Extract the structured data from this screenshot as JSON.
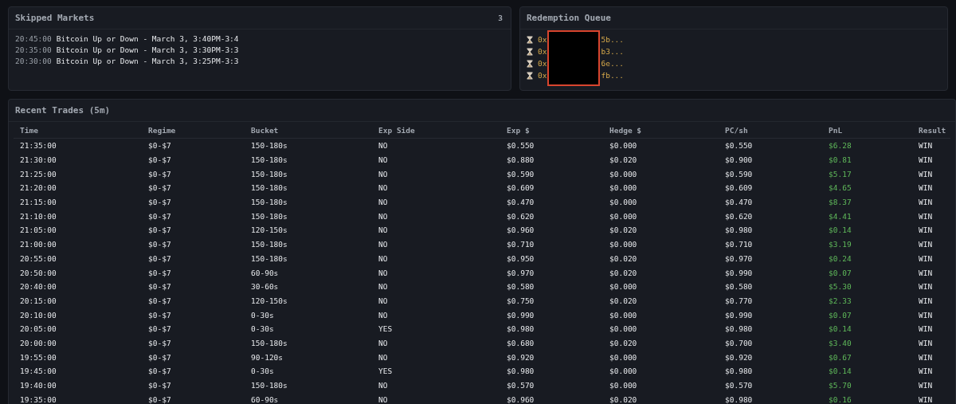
{
  "skipped_markets": {
    "title": "Skipped Markets",
    "count": "3",
    "items": [
      {
        "time": "20:45:00",
        "market": "Bitcoin Up or Down - March 3, 3:40PM-3:4"
      },
      {
        "time": "20:35:00",
        "market": "Bitcoin Up or Down - March 3, 3:30PM-3:3"
      },
      {
        "time": "20:30:00",
        "market": "Bitcoin Up or Down - March 3, 3:25PM-3:3"
      }
    ]
  },
  "redemption_queue": {
    "title": "Redemption Queue",
    "redacted": true,
    "items": [
      {
        "prefix": "0x",
        "suffix": "5b..."
      },
      {
        "prefix": "0x",
        "suffix": "b3..."
      },
      {
        "prefix": "0x",
        "suffix": "6e..."
      },
      {
        "prefix": "0x",
        "suffix": "fb..."
      }
    ]
  },
  "recent_trades": {
    "title": "Recent Trades (5m)",
    "columns": [
      "Time",
      "Regime",
      "Bucket",
      "Exp Side",
      "Exp $",
      "Hedge $",
      "PC/sh",
      "PnL",
      "Result"
    ],
    "rows": [
      [
        "21:35:00",
        "$0-$7",
        "150-180s",
        "NO",
        "$0.550",
        "$0.000",
        "$0.550",
        "$6.28",
        "WIN"
      ],
      [
        "21:30:00",
        "$0-$7",
        "150-180s",
        "NO",
        "$0.880",
        "$0.020",
        "$0.900",
        "$0.81",
        "WIN"
      ],
      [
        "21:25:00",
        "$0-$7",
        "150-180s",
        "NO",
        "$0.590",
        "$0.000",
        "$0.590",
        "$5.17",
        "WIN"
      ],
      [
        "21:20:00",
        "$0-$7",
        "150-180s",
        "NO",
        "$0.609",
        "$0.000",
        "$0.609",
        "$4.65",
        "WIN"
      ],
      [
        "21:15:00",
        "$0-$7",
        "150-180s",
        "NO",
        "$0.470",
        "$0.000",
        "$0.470",
        "$8.37",
        "WIN"
      ],
      [
        "21:10:00",
        "$0-$7",
        "150-180s",
        "NO",
        "$0.620",
        "$0.000",
        "$0.620",
        "$4.41",
        "WIN"
      ],
      [
        "21:05:00",
        "$0-$7",
        "120-150s",
        "NO",
        "$0.960",
        "$0.020",
        "$0.980",
        "$0.14",
        "WIN"
      ],
      [
        "21:00:00",
        "$0-$7",
        "150-180s",
        "NO",
        "$0.710",
        "$0.000",
        "$0.710",
        "$3.19",
        "WIN"
      ],
      [
        "20:55:00",
        "$0-$7",
        "150-180s",
        "NO",
        "$0.950",
        "$0.020",
        "$0.970",
        "$0.24",
        "WIN"
      ],
      [
        "20:50:00",
        "$0-$7",
        "60-90s",
        "NO",
        "$0.970",
        "$0.020",
        "$0.990",
        "$0.07",
        "WIN"
      ],
      [
        "20:40:00",
        "$0-$7",
        "30-60s",
        "NO",
        "$0.580",
        "$0.000",
        "$0.580",
        "$5.30",
        "WIN"
      ],
      [
        "20:15:00",
        "$0-$7",
        "120-150s",
        "NO",
        "$0.750",
        "$0.020",
        "$0.770",
        "$2.33",
        "WIN"
      ],
      [
        "20:10:00",
        "$0-$7",
        "0-30s",
        "NO",
        "$0.990",
        "$0.000",
        "$0.990",
        "$0.07",
        "WIN"
      ],
      [
        "20:05:00",
        "$0-$7",
        "0-30s",
        "YES",
        "$0.980",
        "$0.000",
        "$0.980",
        "$0.14",
        "WIN"
      ],
      [
        "20:00:00",
        "$0-$7",
        "150-180s",
        "NO",
        "$0.680",
        "$0.020",
        "$0.700",
        "$3.40",
        "WIN"
      ],
      [
        "19:55:00",
        "$0-$7",
        "90-120s",
        "NO",
        "$0.920",
        "$0.000",
        "$0.920",
        "$0.67",
        "WIN"
      ],
      [
        "19:45:00",
        "$0-$7",
        "0-30s",
        "YES",
        "$0.980",
        "$0.000",
        "$0.980",
        "$0.14",
        "WIN"
      ],
      [
        "19:40:00",
        "$0-$7",
        "150-180s",
        "NO",
        "$0.570",
        "$0.000",
        "$0.570",
        "$5.70",
        "WIN"
      ],
      [
        "19:35:00",
        "$0-$7",
        "60-90s",
        "NO",
        "$0.960",
        "$0.020",
        "$0.980",
        "$0.16",
        "WIN"
      ]
    ]
  }
}
